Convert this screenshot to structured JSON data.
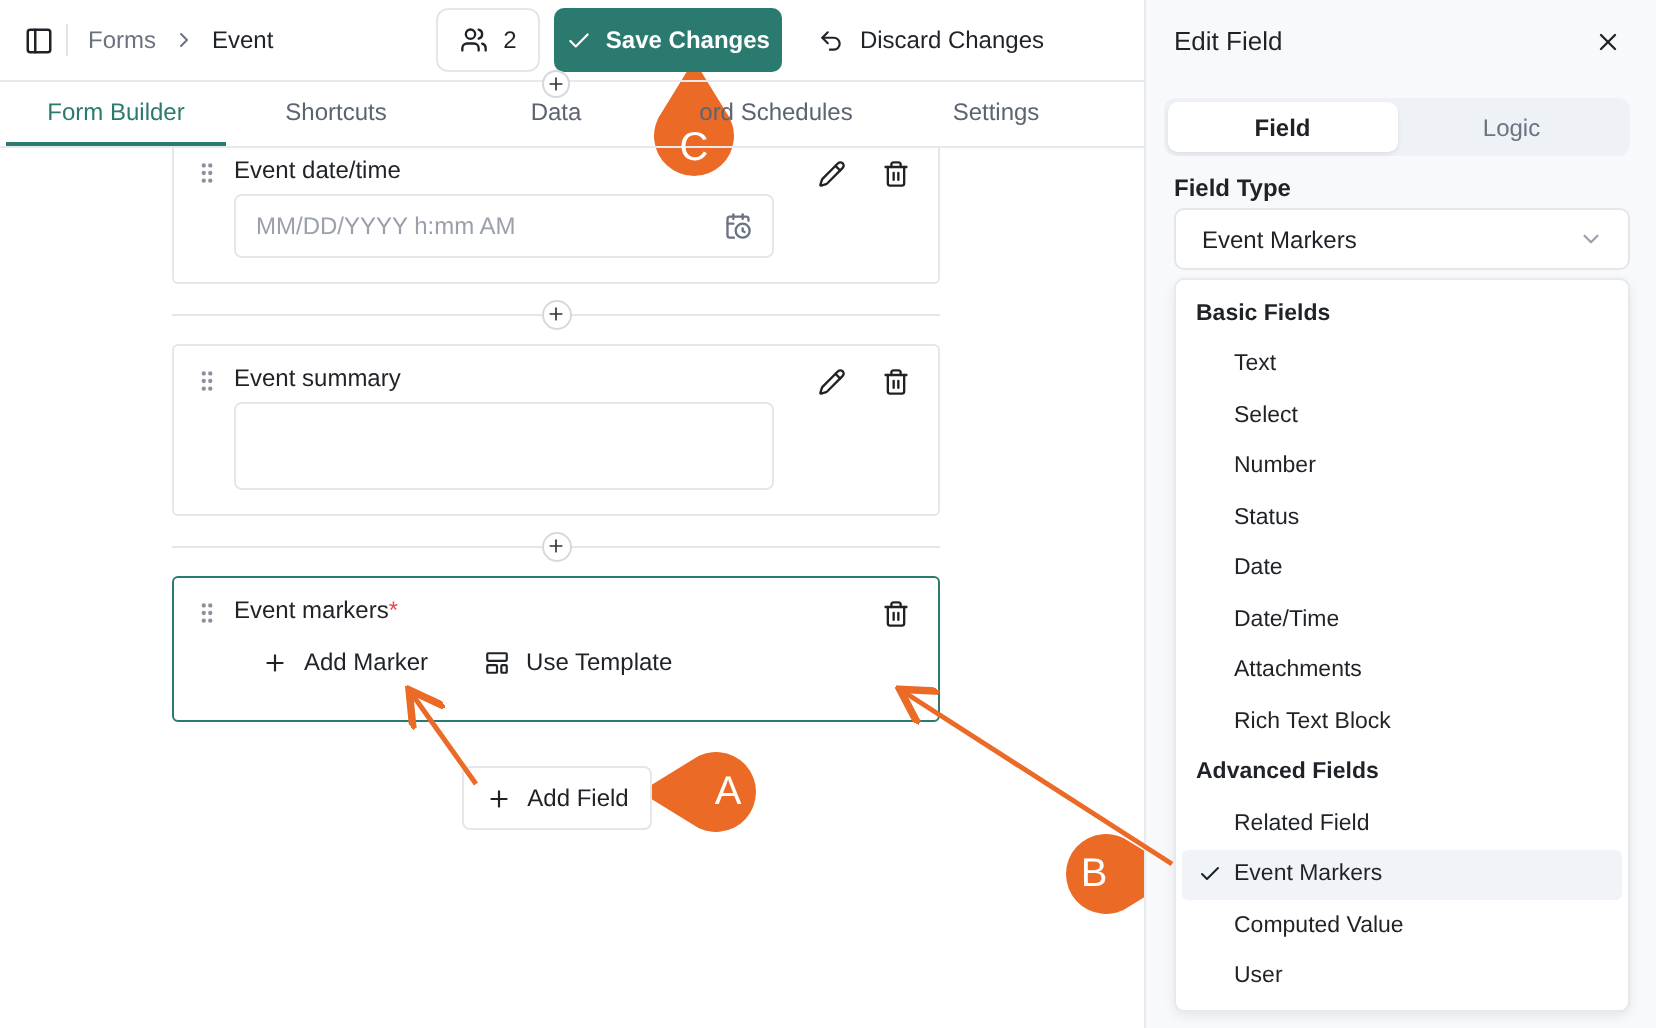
{
  "header": {
    "breadcrumbs": [
      "Forms",
      "Event"
    ],
    "collaborators": "2",
    "save_button": "Save Changes",
    "discard_button": "Discard Changes"
  },
  "tabs": [
    {
      "label": "Form Builder",
      "selected": true
    },
    {
      "label": "Shortcuts",
      "selected": false
    },
    {
      "label": "Data",
      "selected": false
    },
    {
      "label": "ord Schedules",
      "selected": false
    },
    {
      "label": "Settings",
      "selected": false
    }
  ],
  "fields": [
    {
      "kind": "datetime",
      "label": "Event date/time",
      "placeholder": "MM/DD/YYYY h:mm AM",
      "active": false
    },
    {
      "kind": "textarea",
      "label": "Event summary",
      "active": false
    },
    {
      "kind": "markers",
      "label": "Event markers",
      "required_mark": "*",
      "active": true,
      "actions": [
        "Add Marker",
        "Use Template"
      ]
    }
  ],
  "add_field_button": "Add Field",
  "panel": {
    "title": "Edit Field",
    "tabs": [
      {
        "label": "Field",
        "selected": true
      },
      {
        "label": "Logic",
        "selected": false
      }
    ],
    "field_type_label": "Field Type",
    "field_type_value": "Event Markers",
    "groups": [
      {
        "title": "Basic Fields",
        "options": [
          {
            "label": "Text",
            "selected": false
          },
          {
            "label": "Select",
            "selected": false
          },
          {
            "label": "Number",
            "selected": false
          },
          {
            "label": "Status",
            "selected": false
          },
          {
            "label": "Date",
            "selected": false
          },
          {
            "label": "Date/Time",
            "selected": false
          },
          {
            "label": "Attachments",
            "selected": false
          },
          {
            "label": "Rich Text Block",
            "selected": false
          }
        ]
      },
      {
        "title": "Advanced Fields",
        "options": [
          {
            "label": "Related Field",
            "selected": false
          },
          {
            "label": "Event Markers",
            "selected": true
          },
          {
            "label": "Computed Value",
            "selected": false
          },
          {
            "label": "User",
            "selected": false
          }
        ]
      }
    ]
  },
  "callouts": [
    {
      "label": "A"
    },
    {
      "label": "B"
    },
    {
      "label": "C"
    }
  ]
}
